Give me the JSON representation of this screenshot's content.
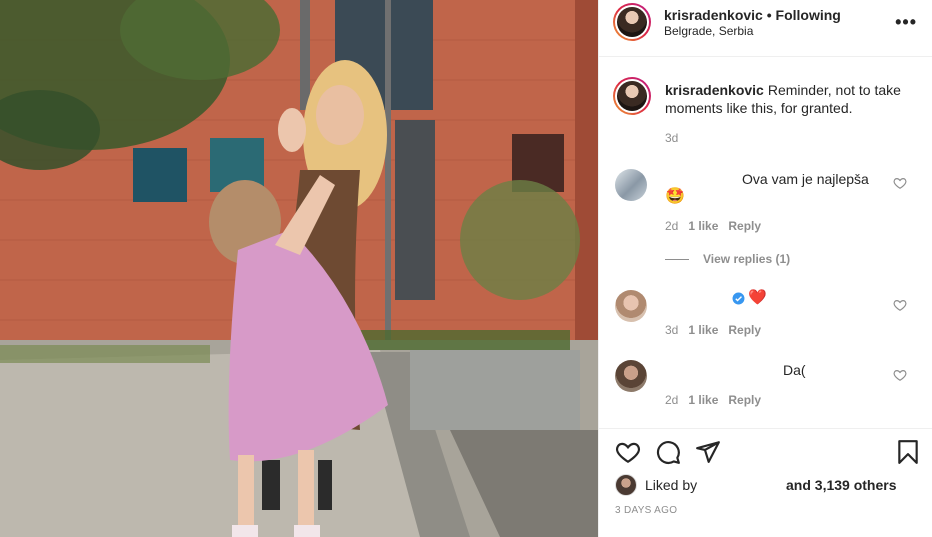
{
  "header": {
    "username": "krisradenkovic",
    "separator": "•",
    "follow_status": "Following",
    "location": "Belgrade, Serbia",
    "more_label": "•••"
  },
  "caption": {
    "username": "krisradenkovic",
    "text": "Reminder, not to take moments like this, for granted.",
    "time": "3d"
  },
  "comments": [
    {
      "text": "Ova vam je najlepša",
      "emoji": "🤩",
      "age": "2d",
      "likes": "1 like",
      "reply": "Reply",
      "view_replies": "View replies (1)"
    },
    {
      "emoji": "❤️",
      "age": "3d",
      "likes": "1 like",
      "reply": "Reply"
    },
    {
      "text": "Da(",
      "age": "2d",
      "likes": "1 like",
      "reply": "Reply"
    }
  ],
  "likes": {
    "liked_by": "Liked by",
    "others": "and 3,139 others"
  },
  "post_date": "3 DAYS AGO",
  "icons": [
    "more-options-icon",
    "heart-icon",
    "comment-icon",
    "share-icon",
    "bookmark-icon",
    "verified-icon"
  ],
  "colors": {
    "accent": "#3897f0",
    "heart": "#ed4956",
    "muted": "#8e8e8e",
    "text": "#262626"
  }
}
